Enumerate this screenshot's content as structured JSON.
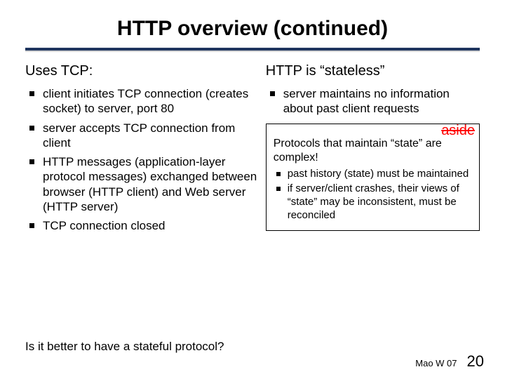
{
  "title": "HTTP overview (continued)",
  "left": {
    "heading": "Uses TCP:",
    "items": [
      "client initiates TCP connection (creates socket) to server, port 80",
      "server accepts TCP connection from client",
      "HTTP messages (application-layer protocol messages) exchanged between browser (HTTP client) and Web server (HTTP server)",
      "TCP connection closed"
    ]
  },
  "right": {
    "heading": "HTTP is “stateless”",
    "items": [
      "server maintains no information about past client requests"
    ]
  },
  "aside": {
    "label": "aside",
    "lead": "Protocols that maintain “state” are complex!",
    "items": [
      "past history (state) must be maintained",
      "if server/client crashes, their views of “state” may be inconsistent, must be reconciled"
    ]
  },
  "question": "Is it better to have a stateful protocol?",
  "footer": {
    "tag": "Mao W 07",
    "page": "20"
  }
}
